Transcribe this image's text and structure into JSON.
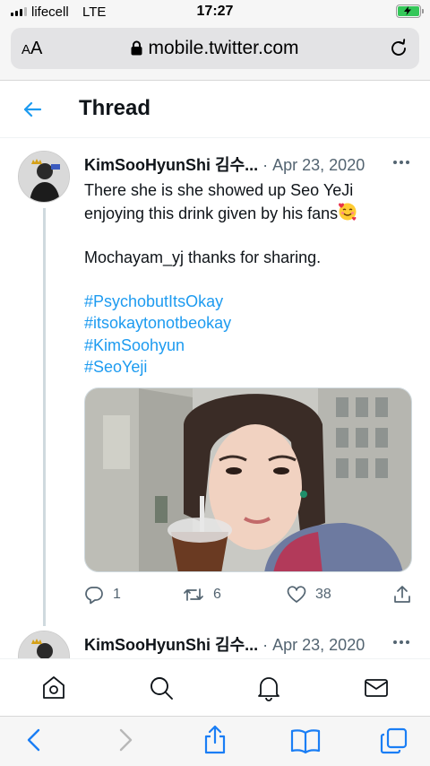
{
  "status_bar": {
    "carrier": "lifecell",
    "network": "LTE",
    "time": "17:27",
    "battery_state": "charging",
    "battery_color": "#34c759"
  },
  "browser": {
    "text_size_label": "AA",
    "url": "mobile.twitter.com"
  },
  "header": {
    "title": "Thread"
  },
  "tweet": {
    "author": "KimSooHyunShi 김수...",
    "separator": " · ",
    "date": "Apr 23, 2020",
    "line1": "There she is she showed up Seo YeJi enjoying this drink given by his fans",
    "line2": "Mochayam_yj thanks for sharing.",
    "hashtags": [
      "#PsychobutItsOkay",
      "#itsokaytonotbeokay",
      "#KimSoohyun",
      "#SeoYeji"
    ],
    "stats": {
      "replies": "1",
      "retweets": "6",
      "likes": "38"
    }
  },
  "tweet2": {
    "author": "KimSooHyunShi 김수...",
    "separator": " · ",
    "date": "Apr 23, 2020"
  },
  "nav": {
    "items": [
      "home-icon",
      "search-icon",
      "notifications-icon",
      "messages-icon"
    ]
  },
  "safari_toolbar": {
    "items": [
      "back-icon",
      "forward-icon",
      "share-icon",
      "bookmarks-icon",
      "tabs-icon"
    ]
  },
  "colors": {
    "accent": "#1d9bf0",
    "secondary_text": "#536471"
  }
}
